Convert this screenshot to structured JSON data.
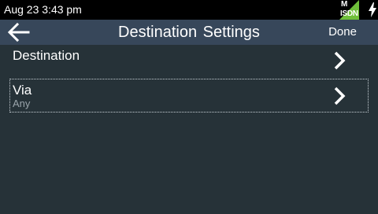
{
  "status_bar": {
    "time": "Aug 23 3:43 pm",
    "network_top": "M",
    "network_bottom": "ISDN",
    "network_color": "#6fbf3a",
    "charging_icon": "bolt-icon"
  },
  "header": {
    "back_icon": "arrow-left-icon",
    "title": "Destination  Settings",
    "done_label": "Done"
  },
  "rows": [
    {
      "label": "Destination",
      "sub": "",
      "icon": "chevron-right-icon"
    },
    {
      "label": "Via",
      "sub": "Any",
      "icon": "chevron-right-icon"
    }
  ],
  "colors": {
    "background": "#263238",
    "header": "#37475a",
    "status_bar": "#000000",
    "subtext": "#9aa4ab"
  }
}
